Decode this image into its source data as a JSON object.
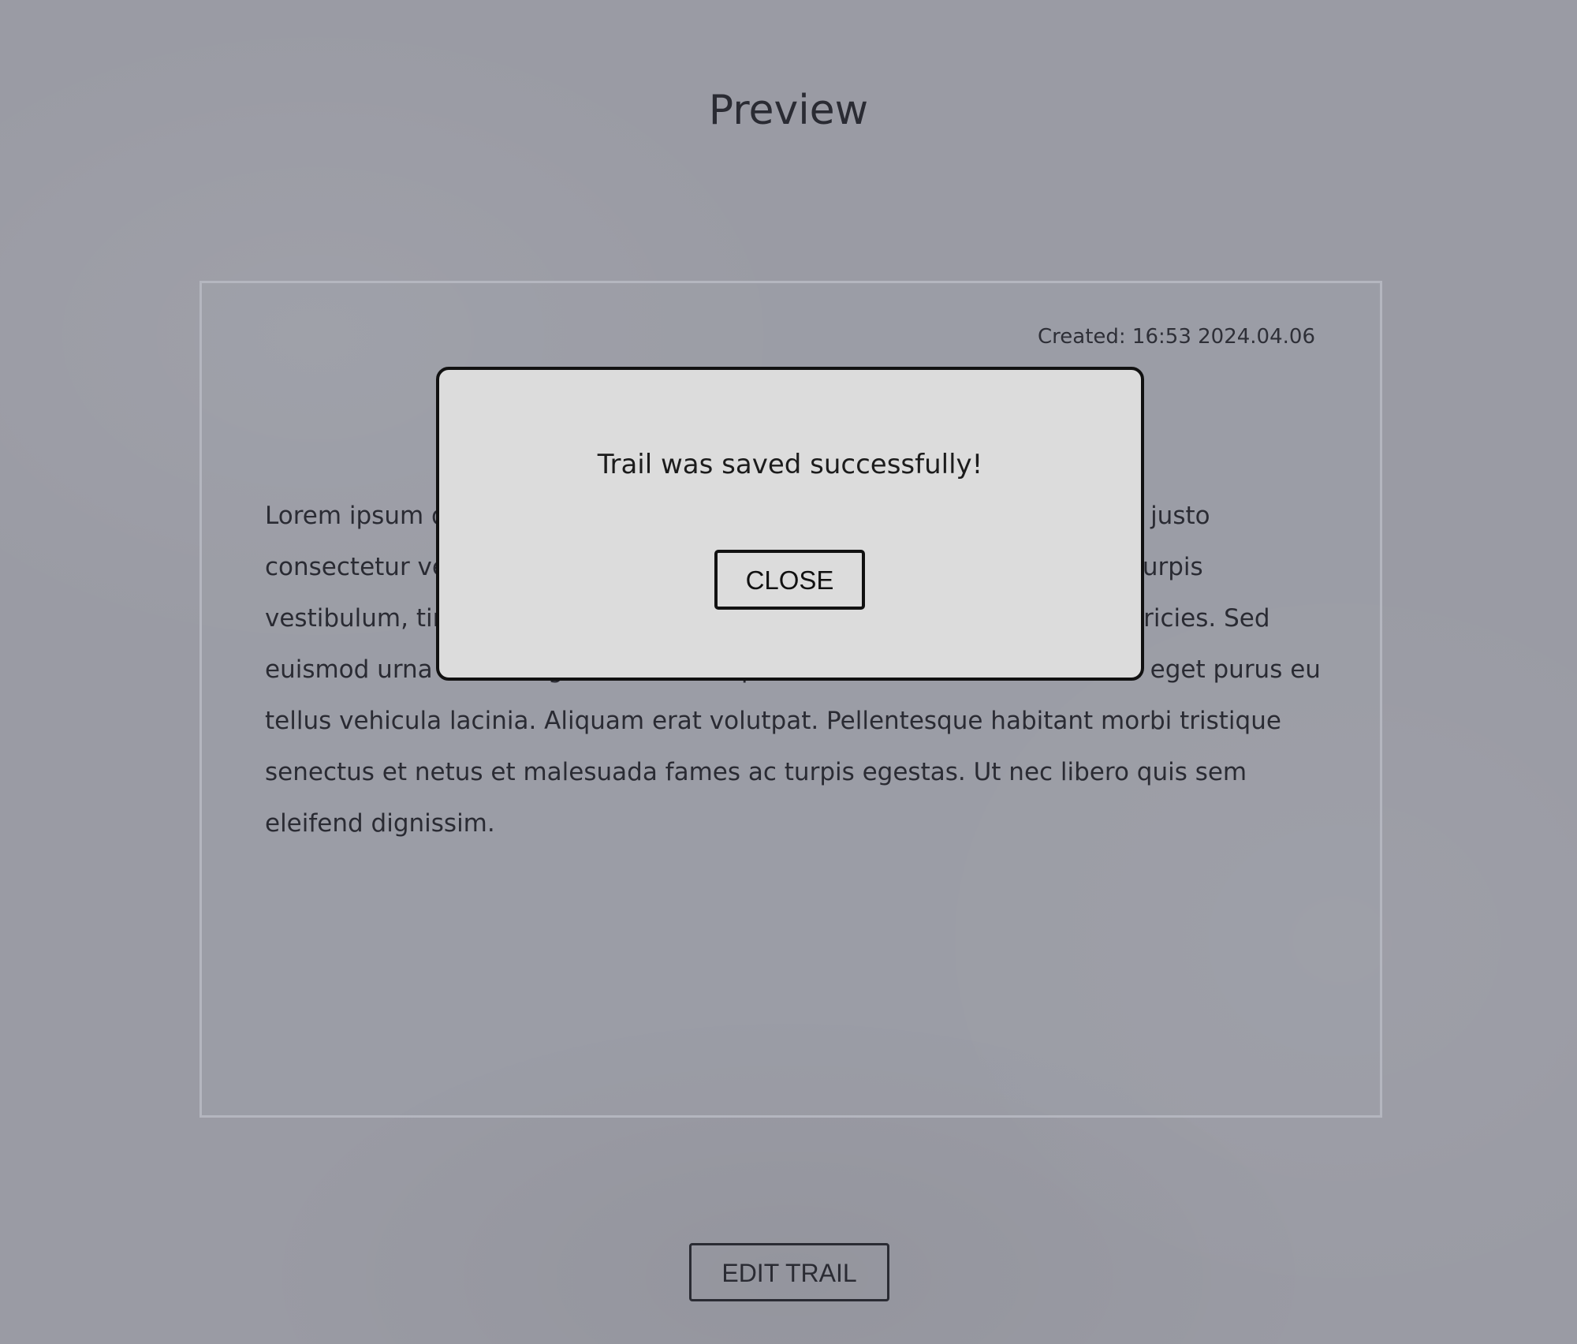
{
  "page": {
    "title": "Preview"
  },
  "card": {
    "created": "Created: 16:53 2024.04.06",
    "body": "Lorem ipsum dolor sit amet, consectetur adipiscing elit. Vestibulum nec justo consectetur velit tristique vestibulum sed eu arcu. Vivamus integer ac turpis vestibulum, tincidunt nisl nec, finibus libero. Quisque et sapien vitae ultricies. Sed euismod urna vitae magna efficitur, in pretium libero venenatis. Nullam eget purus eu tellus vehicula lacinia. Aliquam erat volutpat. Pellentesque habitant morbi tristique senectus et netus et malesuada fames ac turpis egestas. Ut nec libero quis sem eleifend dignissim."
  },
  "actions": {
    "edit_label": "EDIT TRAIL"
  },
  "modal": {
    "message": "Trail was saved successfully!",
    "close_label": "CLOSE"
  },
  "colors": {
    "background": "#9a9ba4",
    "text": "#2a2b33",
    "modal_background": "#dcdcdc",
    "modal_border": "#111111"
  }
}
